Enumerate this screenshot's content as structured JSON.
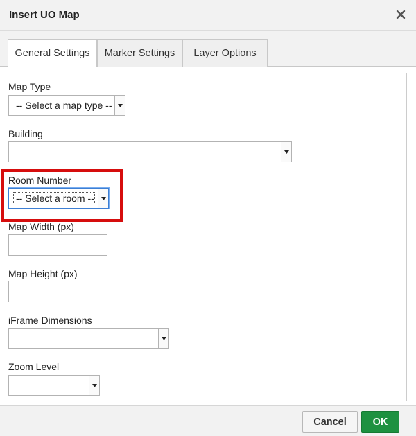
{
  "dialog": {
    "title": "Insert UO Map"
  },
  "tabs": [
    {
      "label": "General Settings",
      "active": true
    },
    {
      "label": "Marker Settings",
      "active": false
    },
    {
      "label": "Layer Options",
      "active": false
    }
  ],
  "fields": {
    "map_type": {
      "label": "Map Type",
      "selected": "-- Select a map type --"
    },
    "building": {
      "label": "Building",
      "selected": ""
    },
    "room_number": {
      "label": "Room Number",
      "selected": "-- Select a room --"
    },
    "map_width": {
      "label": "Map Width (px)",
      "value": ""
    },
    "map_height": {
      "label": "Map Height (px)",
      "value": ""
    },
    "iframe_dimensions": {
      "label": "iFrame Dimensions",
      "selected": ""
    },
    "zoom_level": {
      "label": "Zoom Level",
      "selected": ""
    }
  },
  "footer": {
    "cancel_label": "Cancel",
    "ok_label": "OK"
  },
  "colors": {
    "highlight": "#d60d0d",
    "ok_button": "#1d9140",
    "focus": "#3d7fd4"
  },
  "icons": {
    "close": "close-icon",
    "dropdown": "chevron-down-icon"
  }
}
